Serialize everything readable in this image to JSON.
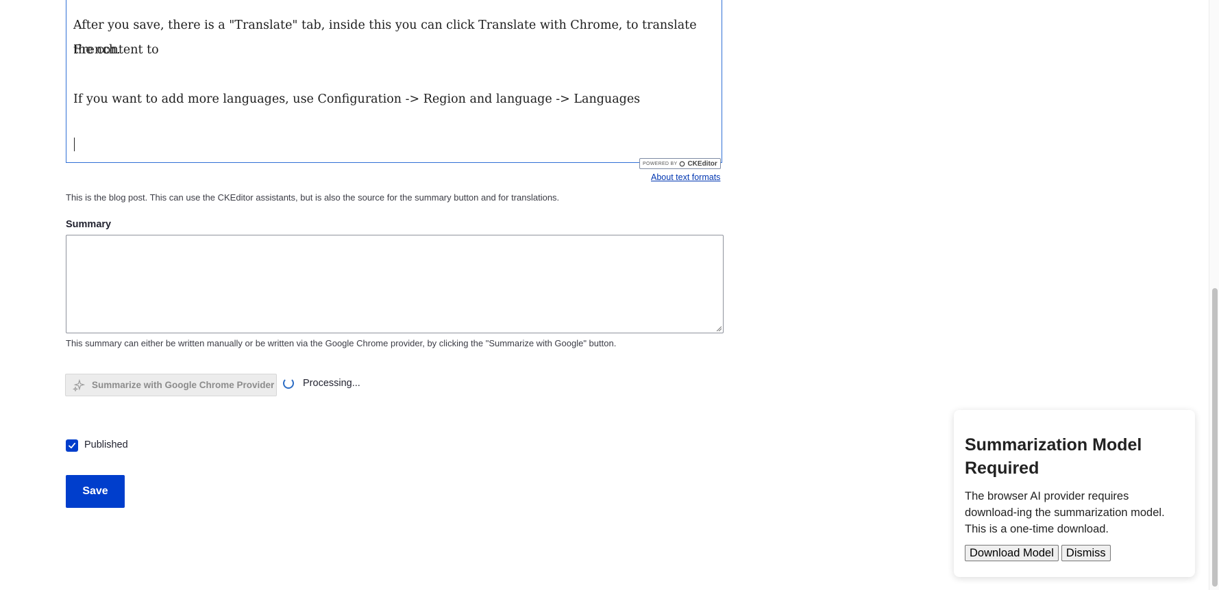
{
  "editor": {
    "paragraph1": "After you save, there is a \"Translate\" tab, inside this you can click Translate with Chrome, to translate the content to",
    "paragraph1_cont": "French.",
    "paragraph2": "If you want to add more languages, use Configuration -> Region and language -> Languages",
    "powered_by": "POWERED BY",
    "powered_brand": "CKEditor",
    "about_link": "About text formats",
    "description": "This is the blog post. This can use the CKEditor assistants, but is also the source for the summary button and for translations."
  },
  "summary": {
    "label": "Summary",
    "value": "",
    "description": "This summary can either be written manually or be written via the Google Chrome provider, by clicking the \"Summarize with Google\" button."
  },
  "summarize_button": {
    "label": "Summarize with Google Chrome Provider",
    "icon": "sparkle-icon",
    "status": "Processing..."
  },
  "published": {
    "label": "Published",
    "checked": true
  },
  "save": {
    "label": "Save"
  },
  "modal": {
    "title": "Summarization Model Required",
    "body": "The browser AI provider requires download-ing the summarization model. This is a one-time download.",
    "download_label": "Download Model",
    "dismiss_label": "Dismiss"
  },
  "colors": {
    "primary": "#003ecc",
    "editor_border": "#2f6fd6",
    "link": "#0036b1"
  }
}
